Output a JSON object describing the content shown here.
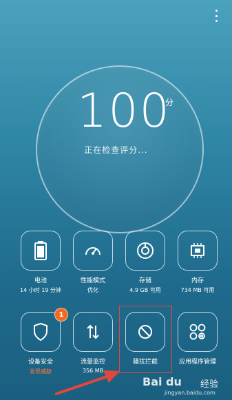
{
  "score": {
    "value": "100",
    "unit": "分",
    "status": "正在检查评分..."
  },
  "tiles_row1": [
    {
      "name": "battery",
      "label": "电池",
      "sub": "14 小时 19 分钟"
    },
    {
      "name": "performance",
      "label": "性能模式",
      "sub": "优化"
    },
    {
      "name": "storage",
      "label": "存储",
      "sub": "4.9 GB 可用"
    },
    {
      "name": "memory",
      "label": "内存",
      "sub": "734 MB 可用"
    }
  ],
  "tiles_row2": [
    {
      "name": "device-security",
      "label": "设备安全",
      "sub": "发现威胁",
      "badge": "1"
    },
    {
      "name": "data-monitor",
      "label": "流量监控",
      "sub": "356 MB"
    },
    {
      "name": "harassment-block",
      "label": "骚扰拦截",
      "sub": ""
    },
    {
      "name": "app-manager",
      "label": "应用程序管理",
      "sub": ""
    }
  ],
  "watermark": {
    "logo": "Bai du",
    "text": "经验",
    "url": "jingyan.baidu.com"
  },
  "colors": {
    "alert": "#ff7a42",
    "badge": "#f26a22",
    "highlight": "#e2473e",
    "arrow": "#e2473e"
  }
}
